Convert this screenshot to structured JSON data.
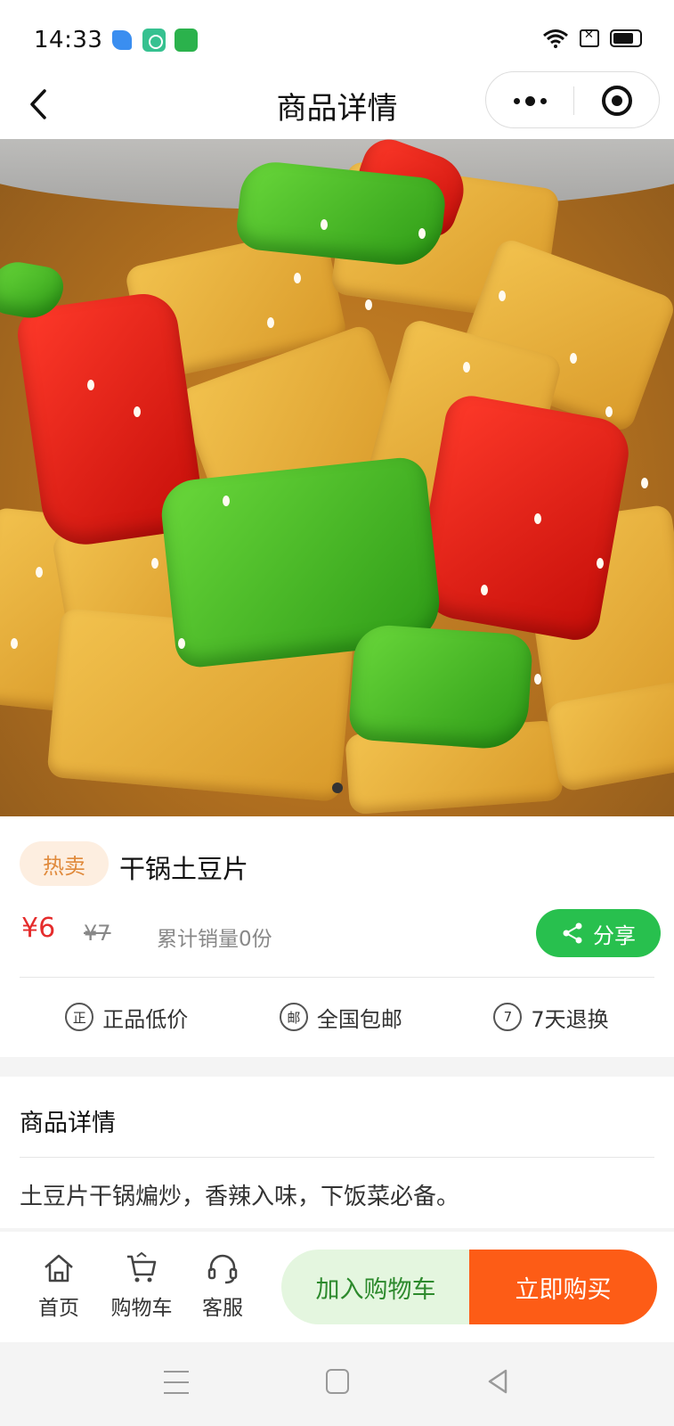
{
  "status_bar": {
    "time": "14:33"
  },
  "nav": {
    "title": "商品详情"
  },
  "product": {
    "tag": "热卖",
    "name": "干锅土豆片",
    "price": "¥6",
    "original_price": "¥7",
    "sales": "累计销量0份",
    "share_label": "分享"
  },
  "guarantees": [
    {
      "icon_char": "正",
      "label": "正品低价"
    },
    {
      "icon_char": "邮",
      "label": "全国包邮"
    },
    {
      "icon_char": "7",
      "label": "7天退换"
    }
  ],
  "detail": {
    "title": "商品详情",
    "description": "土豆片干锅煸炒，香辣入味，下饭菜必备。"
  },
  "action_bar": {
    "home_label": "首页",
    "cart_label": "购物车",
    "service_label": "客服",
    "add_to_cart_label": "加入购物车",
    "buy_now_label": "立即购买"
  },
  "colors": {
    "price_red": "#e52c2c",
    "share_green": "#28c04e",
    "buy_orange": "#fd5c16",
    "cart_bg": "#e4f6df",
    "tag_bg": "#fdeee0",
    "tag_text": "#e08a3c"
  }
}
